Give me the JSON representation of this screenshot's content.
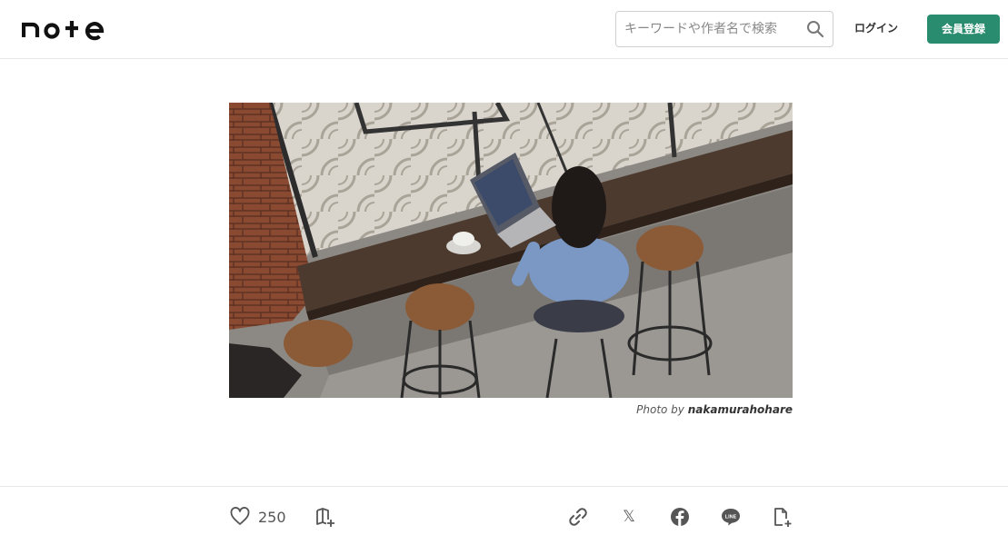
{
  "header": {
    "logo_text": "note",
    "search_placeholder": "キーワードや作者名で検索",
    "login_label": "ログイン",
    "signup_label": "会員登録"
  },
  "hero": {
    "credit_prefix": "Photo by",
    "credit_author": "nakamurahohare"
  },
  "actions": {
    "like_count": "250",
    "icons": [
      "heart-icon",
      "magazine-add-icon",
      "link-icon",
      "x-icon",
      "facebook-icon",
      "line-icon",
      "note-add-icon"
    ]
  },
  "colors": {
    "brand": "#2a8c6e",
    "border": "#e6e6e6"
  }
}
